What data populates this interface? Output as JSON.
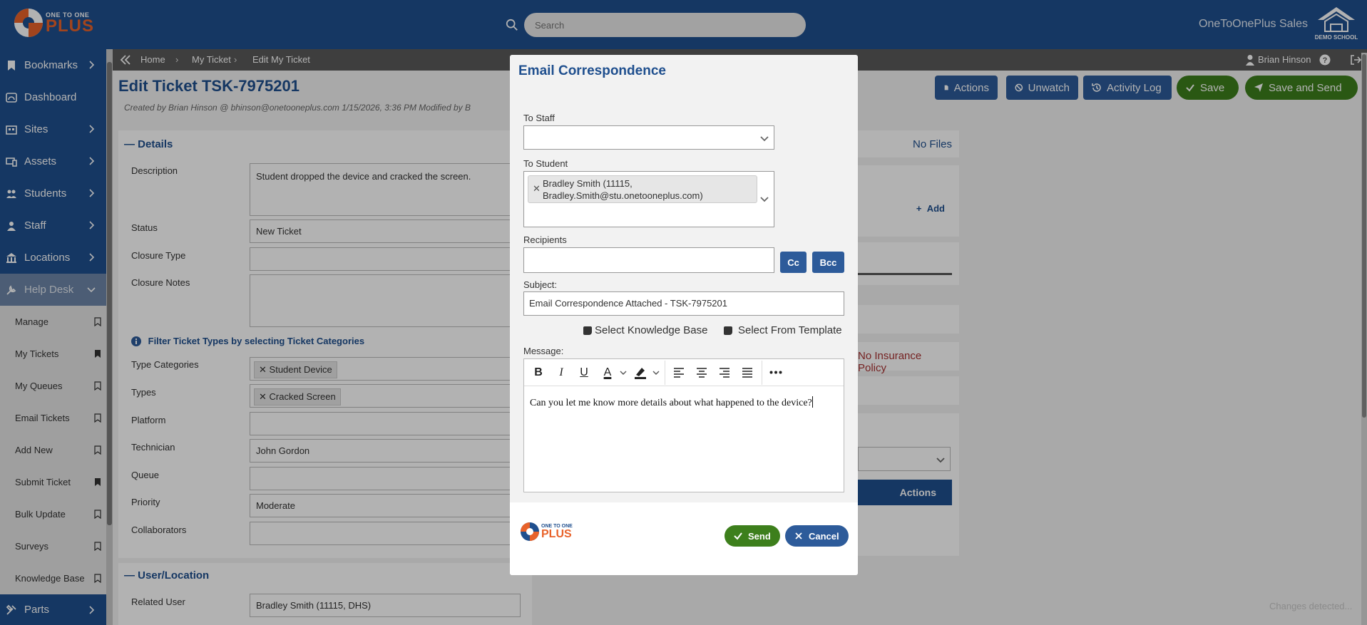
{
  "brand": {
    "small": "ONE TO ONE",
    "big": "PLUS",
    "district": "DEMO SCHOOL"
  },
  "search": {
    "placeholder": "Search"
  },
  "org_name": "OneToOnePlus Sales",
  "user": {
    "name": "Brian Hinson"
  },
  "breadcrumb": {
    "home": "Home",
    "my_ticket": "My Ticket",
    "current": "Edit My Ticket"
  },
  "sidebar": {
    "items": [
      {
        "label": "Bookmarks",
        "icon": "bookmark-icon"
      },
      {
        "label": "Dashboard",
        "icon": "dashboard-icon"
      },
      {
        "label": "Sites",
        "icon": "sites-icon"
      },
      {
        "label": "Assets",
        "icon": "assets-icon"
      },
      {
        "label": "Students",
        "icon": "students-icon"
      },
      {
        "label": "Staff",
        "icon": "staff-icon"
      },
      {
        "label": "Locations",
        "icon": "locations-icon"
      },
      {
        "label": "Help Desk",
        "icon": "helpdesk-icon"
      }
    ],
    "sub_items": [
      {
        "label": "Manage"
      },
      {
        "label": "My Tickets"
      },
      {
        "label": "My Queues"
      },
      {
        "label": "Email Tickets"
      },
      {
        "label": "Add New"
      },
      {
        "label": "Submit Ticket"
      },
      {
        "label": "Bulk Update"
      },
      {
        "label": "Surveys"
      },
      {
        "label": "Knowledge Base"
      }
    ],
    "parts": {
      "label": "Parts"
    }
  },
  "page": {
    "title": "Edit Ticket TSK-7975201",
    "created": "Created by Brian Hinson @ bhinson@onetooneplus.com 1/15/2026, 3:36 PM    Modified by B",
    "toolbar": {
      "actions": "Actions",
      "unwatch": "Unwatch",
      "activity": "Activity Log",
      "save": "Save",
      "save_send": "Save and Send"
    },
    "details_heading": "Details",
    "fields": {
      "description_label": "Description",
      "description": "Student dropped the device and cracked the screen.",
      "status_label": "Status",
      "status": "New Ticket",
      "closure_type_label": "Closure Type",
      "closure_notes_label": "Closure Notes",
      "filter_hint": "Filter Ticket Types by selecting Ticket Categories",
      "type_categories_label": "Type Categories",
      "type_category": "Student Device",
      "types_label": "Types",
      "type": "Cracked Screen",
      "platform_label": "Platform",
      "technician_label": "Technician",
      "technician": "John Gordon",
      "queue_label": "Queue",
      "priority_label": "Priority",
      "priority": "Moderate",
      "collaborators_label": "Collaborators"
    },
    "user_location_heading": "User/Location",
    "related_user_label": "Related User",
    "related_user": "Bradley Smith (11115, DHS)",
    "right": {
      "no_files": "No Files",
      "add": "Add",
      "no_insurance": "No Insurance Policy",
      "actions_header": "Actions",
      "changes": "Changes detected..."
    }
  },
  "modal": {
    "title": "Email Correspondence",
    "to_staff_label": "To Staff",
    "to_student_label": "To Student",
    "student_line1": "Bradley Smith (11115,",
    "student_line2": "Bradley.Smith@stu.onetooneplus.com)",
    "recipients_label": "Recipients",
    "cc": "Cc",
    "bcc": "Bcc",
    "subject_label": "Subject:",
    "subject": "Email Correspondence Attached - TSK-7975201",
    "select_kb": "Select Knowledge Base",
    "select_template": "Select From Template",
    "message_label": "Message:",
    "message": "Can you let me know more details about what happened to the device?",
    "send": "Send",
    "cancel": "Cancel"
  },
  "colors": {
    "brand_blue": "#1f4f8e",
    "brand_orange": "#e8622a",
    "send_green": "#3d7f1c",
    "danger_red": "#a83232"
  }
}
